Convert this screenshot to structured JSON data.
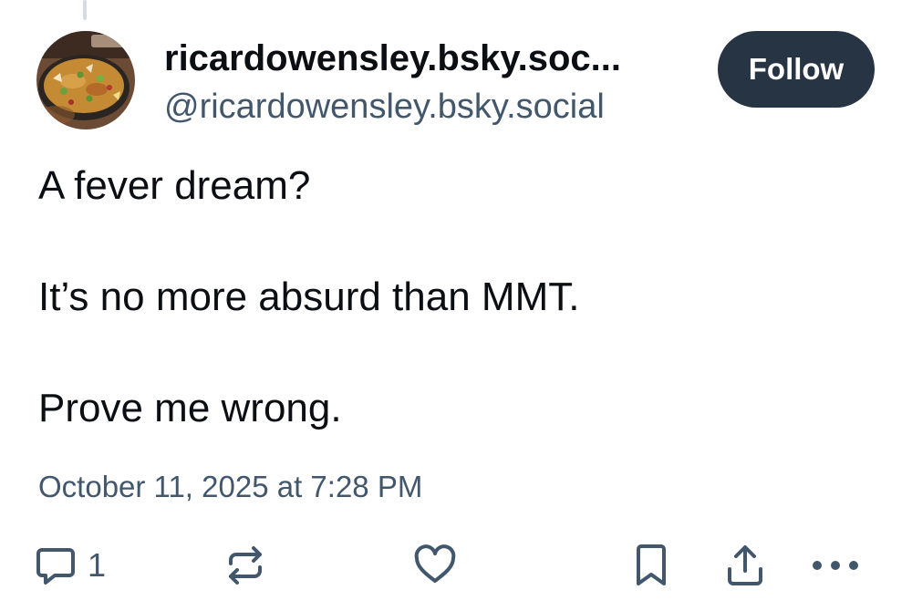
{
  "author": {
    "display_name": "ricardowensley.bsky.soc...",
    "handle": "@ricardowensley.bsky.social",
    "avatar_icon": "paella-pan-avatar"
  },
  "follow_button": {
    "label": "Follow"
  },
  "post": {
    "lines": [
      "A fever dream?",
      "It’s no more absurd than MMT.",
      "Prove me wrong."
    ],
    "timestamp": "October 11, 2025 at 7:28 PM"
  },
  "actions": {
    "reply": {
      "icon": "reply-bubble-icon",
      "count": "1"
    },
    "repost": {
      "icon": "repost-icon"
    },
    "like": {
      "icon": "heart-icon"
    },
    "bookmark": {
      "icon": "bookmark-icon"
    },
    "share": {
      "icon": "share-icon"
    },
    "more": {
      "icon": "more-dots-icon"
    }
  },
  "colors": {
    "text_primary": "#0b0f14",
    "text_secondary": "#42576c",
    "button_bg": "#263443",
    "thread_line": "#d4dbe2"
  }
}
